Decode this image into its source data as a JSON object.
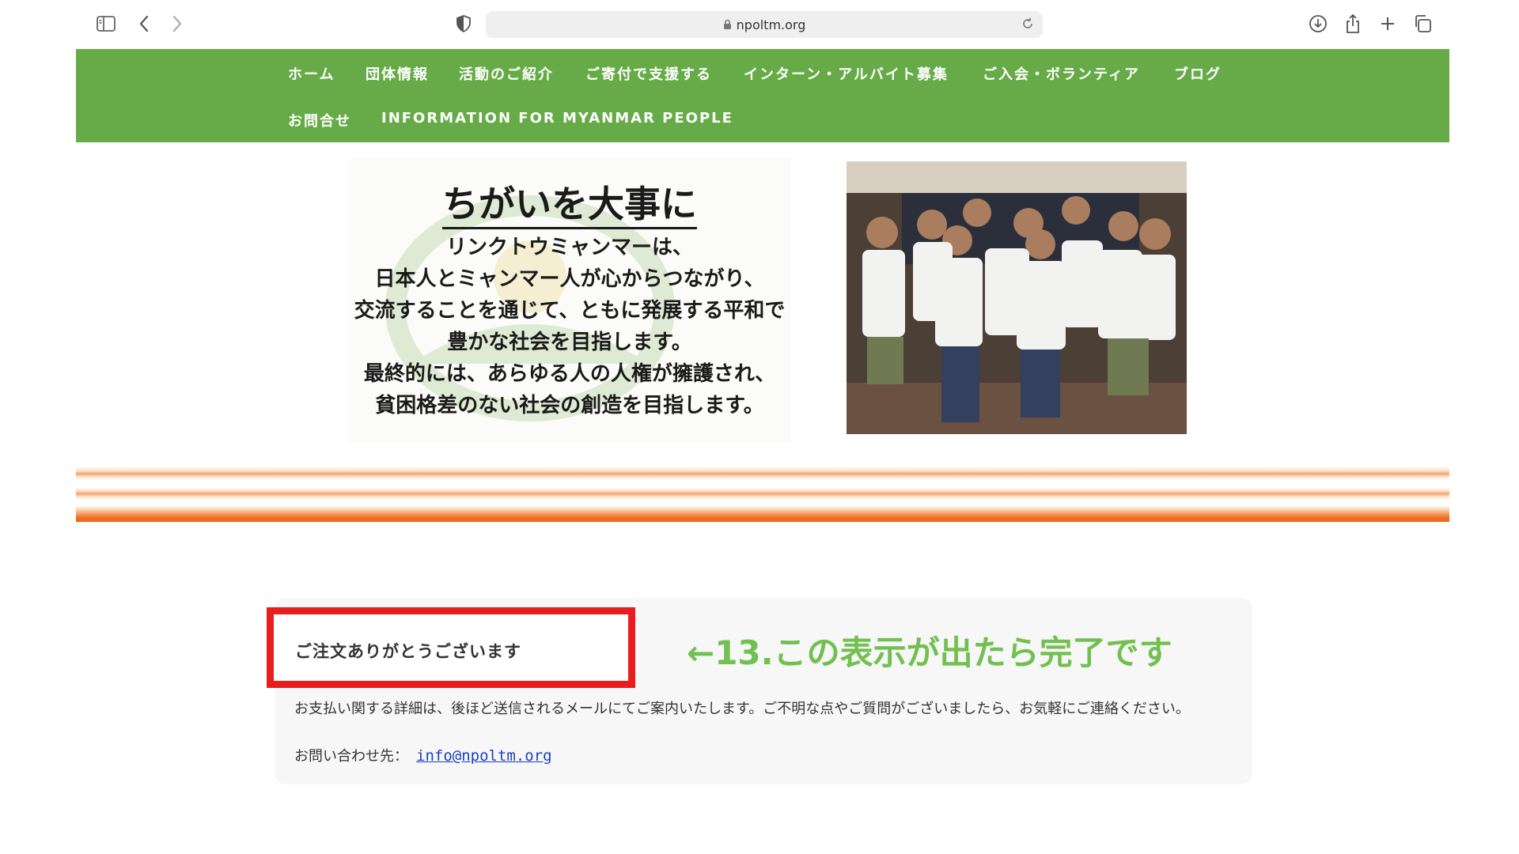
{
  "browser": {
    "url": "npoltm.org"
  },
  "nav": {
    "items": [
      "ホーム",
      "団体情報",
      "活動のご紹介",
      "ご寄付で支援する",
      "インターン・アルバイト募集",
      "ご入会・ボランティア",
      "ブログ",
      "お問合せ",
      "INFORMATION FOR MYANMAR PEOPLE"
    ],
    "color": "#67ab48"
  },
  "hero": {
    "title": "ちがいを大事に",
    "lines": [
      "リンクトウミャンマーは、",
      "日本人とミャンマー人が心からつながり、",
      "交流することを通じて、ともに発展する平和で",
      "豊かな社会を目指します。",
      "最終的には、あらゆる人の人権が擁護され、",
      "貧困格差のない社会の創造を目指します。"
    ]
  },
  "order": {
    "thanks": "ご注文ありがとうございます",
    "detail": "お支払い関する詳細は、後ほど送信されるメールにてご案内いたします。ご不明な点やご質問がございましたら、お気軽にご連絡ください。",
    "contact_label": "お問い合わせ先：",
    "contact_email": "info@npoltm.org"
  },
  "annotation": {
    "text": "←13.この表示が出たら完了です",
    "color": "#72c050",
    "highlight_color": "#e81e1e"
  }
}
